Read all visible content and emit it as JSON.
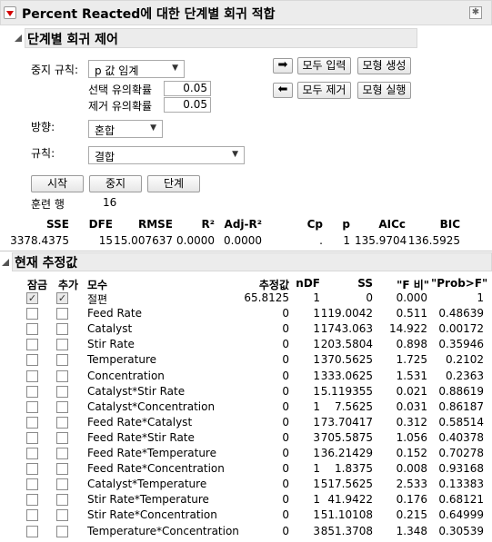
{
  "title": "Percent Reacted에 대한 단계별 회귀 적합",
  "control": {
    "section_title": "단계별 회귀 제어",
    "stop_rule_label": "중지 규칙:",
    "stop_rule_value": "p 값 임계",
    "p_enter_label": "선택 유의확률",
    "p_enter_value": "0.05",
    "p_leave_label": "제거 유의확률",
    "p_leave_value": "0.05",
    "direction_label": "방향:",
    "direction_value": "혼합",
    "rules_label": "규칙:",
    "rules_value": "결합",
    "enter_all": "모두 입력",
    "remove_all": "모두 제거",
    "make_model": "모형 생성",
    "run_model": "모형 실행",
    "go": "시작",
    "stop": "중지",
    "step": "단계",
    "training_rows_label": "훈련 행",
    "training_rows_value": "16"
  },
  "stats": {
    "headers": [
      "SSE",
      "DFE",
      "RMSE",
      "R²",
      "Adj-R²",
      "Cp",
      "p",
      "AICc",
      "BIC"
    ],
    "values": [
      "3378.4375",
      "15",
      "15.007637",
      "0.0000",
      "0.0000",
      ".",
      "1",
      "135.9704",
      "136.5925"
    ]
  },
  "estimates": {
    "section_title": "현재 추정값",
    "headers": [
      "잠금",
      "추가",
      "모수",
      "추정값",
      "nDF",
      "SS",
      "\"F 비\"",
      "\"Prob>F\""
    ],
    "rows": [
      {
        "lock": true,
        "entered": true,
        "param": "절편",
        "est": "65.8125",
        "ndf": "1",
        "ss": "0",
        "f": "0.000",
        "p": "1"
      },
      {
        "lock": false,
        "entered": false,
        "param": "Feed Rate",
        "est": "0",
        "ndf": "1",
        "ss": "119.0042",
        "f": "0.511",
        "p": "0.48639"
      },
      {
        "lock": false,
        "entered": false,
        "param": "Catalyst",
        "est": "0",
        "ndf": "1",
        "ss": "1743.063",
        "f": "14.922",
        "p": "0.00172"
      },
      {
        "lock": false,
        "entered": false,
        "param": "Stir Rate",
        "est": "0",
        "ndf": "1",
        "ss": "203.5804",
        "f": "0.898",
        "p": "0.35946"
      },
      {
        "lock": false,
        "entered": false,
        "param": "Temperature",
        "est": "0",
        "ndf": "1",
        "ss": "370.5625",
        "f": "1.725",
        "p": "0.2102"
      },
      {
        "lock": false,
        "entered": false,
        "param": "Concentration",
        "est": "0",
        "ndf": "1",
        "ss": "333.0625",
        "f": "1.531",
        "p": "0.2363"
      },
      {
        "lock": false,
        "entered": false,
        "param": "Catalyst*Stir Rate",
        "est": "0",
        "ndf": "1",
        "ss": "5.119355",
        "f": "0.021",
        "p": "0.88619"
      },
      {
        "lock": false,
        "entered": false,
        "param": "Catalyst*Concentration",
        "est": "0",
        "ndf": "1",
        "ss": "7.5625",
        "f": "0.031",
        "p": "0.86187"
      },
      {
        "lock": false,
        "entered": false,
        "param": "Feed Rate*Catalyst",
        "est": "0",
        "ndf": "1",
        "ss": "73.70417",
        "f": "0.312",
        "p": "0.58514"
      },
      {
        "lock": false,
        "entered": false,
        "param": "Feed Rate*Stir Rate",
        "est": "0",
        "ndf": "3",
        "ss": "705.5875",
        "f": "1.056",
        "p": "0.40378"
      },
      {
        "lock": false,
        "entered": false,
        "param": "Feed Rate*Temperature",
        "est": "0",
        "ndf": "1",
        "ss": "36.21429",
        "f": "0.152",
        "p": "0.70278"
      },
      {
        "lock": false,
        "entered": false,
        "param": "Feed Rate*Concentration",
        "est": "0",
        "ndf": "1",
        "ss": "1.8375",
        "f": "0.008",
        "p": "0.93168"
      },
      {
        "lock": false,
        "entered": false,
        "param": "Catalyst*Temperature",
        "est": "0",
        "ndf": "1",
        "ss": "517.5625",
        "f": "2.533",
        "p": "0.13383"
      },
      {
        "lock": false,
        "entered": false,
        "param": "Stir Rate*Temperature",
        "est": "0",
        "ndf": "1",
        "ss": "41.9422",
        "f": "0.176",
        "p": "0.68121"
      },
      {
        "lock": false,
        "entered": false,
        "param": "Stir Rate*Concentration",
        "est": "0",
        "ndf": "1",
        "ss": "51.10108",
        "f": "0.215",
        "p": "0.64999"
      },
      {
        "lock": false,
        "entered": false,
        "param": "Temperature*Concentration",
        "est": "0",
        "ndf": "3",
        "ss": "851.3708",
        "f": "1.348",
        "p": "0.30539"
      }
    ]
  }
}
